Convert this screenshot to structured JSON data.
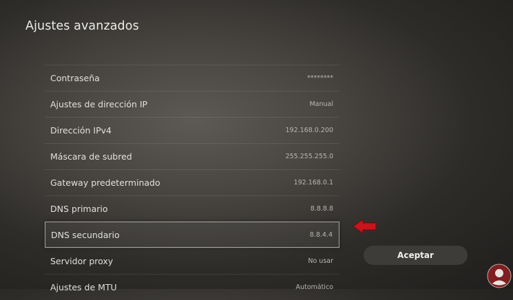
{
  "header": {
    "title": "Ajustes avanzados"
  },
  "settings": [
    {
      "label": "Contraseña",
      "value": "********"
    },
    {
      "label": "Ajustes de dirección IP",
      "value": "Manual"
    },
    {
      "label": "Dirección IPv4",
      "value": "192.168.0.200"
    },
    {
      "label": "Máscara de subred",
      "value": "255.255.255.0"
    },
    {
      "label": "Gateway predeterminado",
      "value": "192.168.0.1"
    },
    {
      "label": "DNS primario",
      "value": "8.8.8.8"
    },
    {
      "label": "DNS secundario",
      "value": "8.8.4.4"
    },
    {
      "label": "Servidor proxy",
      "value": "No usar"
    },
    {
      "label": "Ajustes de MTU",
      "value": "Automático"
    }
  ],
  "actions": {
    "accept_label": "Aceptar"
  },
  "annotation": {
    "arrow_color": "#c8141c",
    "icon": "arrow-left-icon"
  },
  "watermark": {
    "icon": "solvetic-logo-icon"
  }
}
